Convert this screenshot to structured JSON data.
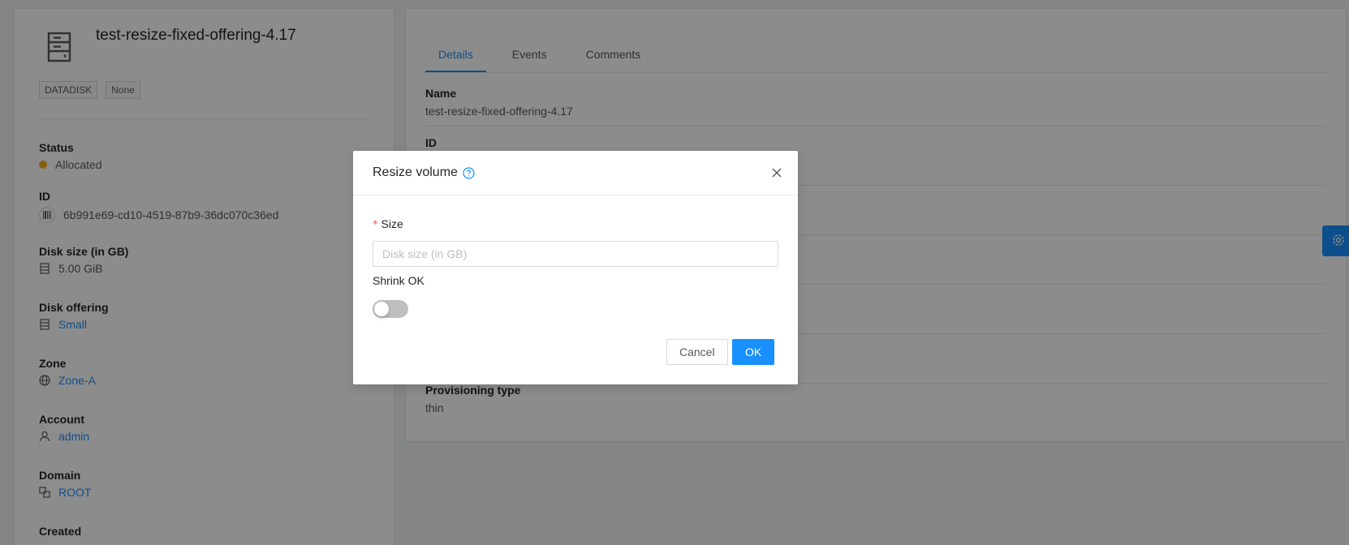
{
  "resource": {
    "title": "test-resize-fixed-offering-4.17",
    "tags": [
      "DATADISK",
      "None"
    ]
  },
  "left_fields": {
    "status": {
      "label": "Status",
      "value": "Allocated",
      "color": "#faad14"
    },
    "id": {
      "label": "ID",
      "value": "6b991e69-cd10-4519-87b9-36dc070c36ed"
    },
    "disk_size": {
      "label": "Disk size (in GB)",
      "value": "5.00 GiB"
    },
    "disk_offering": {
      "label": "Disk offering",
      "value": "Small"
    },
    "zone": {
      "label": "Zone",
      "value": "Zone-A"
    },
    "account": {
      "label": "Account",
      "value": "admin"
    },
    "domain": {
      "label": "Domain",
      "value": "ROOT"
    },
    "created": {
      "label": "Created"
    }
  },
  "tabs": [
    "Details",
    "Events",
    "Comments"
  ],
  "details": {
    "name": {
      "label": "Name",
      "value": "test-resize-fixed-offering-4.17"
    },
    "id": {
      "label": "ID"
    },
    "provisioning": {
      "label": "Provisioning type",
      "value": "thin"
    }
  },
  "modal": {
    "title": "Resize volume",
    "size_label": "Size",
    "size_required_mark": "*",
    "size_placeholder": "Disk size (in GB)",
    "shrink_label": "Shrink OK",
    "shrink_on": false,
    "cancel_label": "Cancel",
    "ok_label": "OK"
  },
  "colors": {
    "primary": "#1890ff",
    "warning": "#faad14"
  }
}
